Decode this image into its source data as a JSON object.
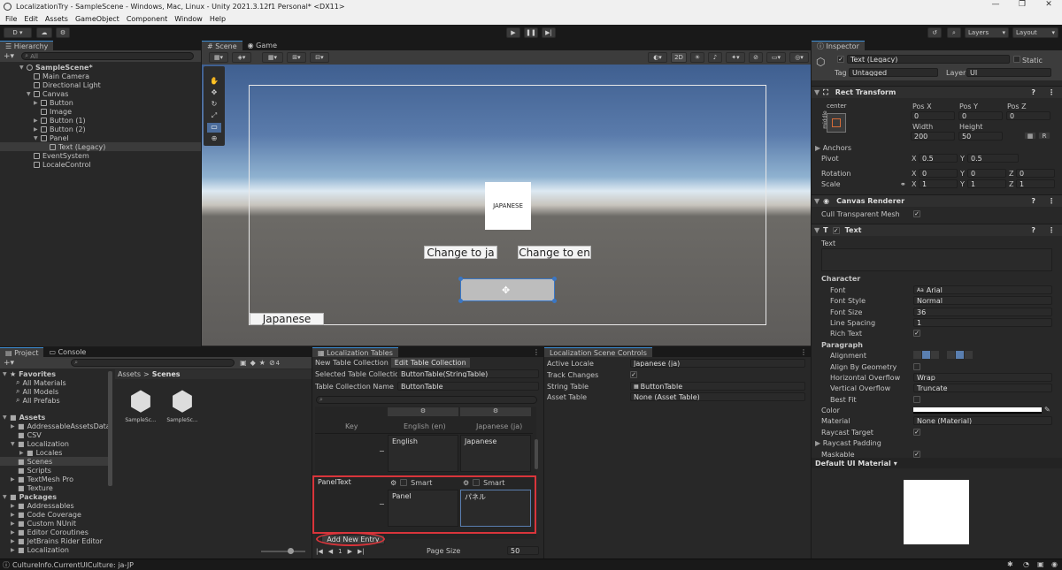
{
  "window": {
    "title": "LocalizationTry - SampleScene - Windows, Mac, Linux - Unity 2021.3.12f1 Personal* <DX11>",
    "minimize": "—",
    "maximize": "❐",
    "close": "✕"
  },
  "menu": [
    "File",
    "Edit",
    "Assets",
    "GameObject",
    "Component",
    "Window",
    "Help"
  ],
  "toolbar": {
    "account": "D",
    "layers": "Layers",
    "layout": "Layout"
  },
  "hierarchy": {
    "tab": "Hierarchy",
    "search_placeholder": "All",
    "items": [
      {
        "label": "SampleScene*",
        "depth": 0
      },
      {
        "label": "Main Camera",
        "depth": 1
      },
      {
        "label": "Directional Light",
        "depth": 1
      },
      {
        "label": "Canvas",
        "depth": 1
      },
      {
        "label": "Button",
        "depth": 2
      },
      {
        "label": "Image",
        "depth": 2
      },
      {
        "label": "Button (1)",
        "depth": 2
      },
      {
        "label": "Button (2)",
        "depth": 2
      },
      {
        "label": "Panel",
        "depth": 2
      },
      {
        "label": "Text (Legacy)",
        "depth": 3
      },
      {
        "label": "EventSystem",
        "depth": 1
      },
      {
        "label": "LocaleControl",
        "depth": 1
      }
    ]
  },
  "scene": {
    "tab_scene": "Scene",
    "tab_game": "Game",
    "mode_2d": "2D",
    "panel_text": "JAPANESE",
    "btn_ja": "Change to ja",
    "btn_en": "Change to en",
    "btn_japanese": "Japanese"
  },
  "inspector": {
    "tab": "Inspector",
    "object_name": "Text (Legacy)",
    "static_label": "Static",
    "tag_label": "Tag",
    "tag_value": "Untagged",
    "layer_label": "Layer",
    "layer_value": "UI",
    "rect_transform": "Rect Transform",
    "anchor_preset": "center",
    "anchor_side": "middle",
    "pos_x_label": "Pos X",
    "pos_x": "0",
    "pos_y_label": "Pos Y",
    "pos_y": "0",
    "pos_z_label": "Pos Z",
    "pos_z": "0",
    "width_label": "Width",
    "width": "200",
    "height_label": "Height",
    "height": "50",
    "anchors": "Anchors",
    "pivot_label": "Pivot",
    "pivot_x": "0.5",
    "pivot_y": "0.5",
    "rotation_label": "Rotation",
    "rot_x": "0",
    "rot_y": "0",
    "rot_z": "0",
    "scale_label": "Scale",
    "scale_x": "1",
    "scale_y": "1",
    "scale_z": "1",
    "canvas_renderer": "Canvas Renderer",
    "cull_label": "Cull Transparent Mesh",
    "text_component": "Text",
    "text_label": "Text",
    "character": "Character",
    "font_label": "Font",
    "font_value": "Arial",
    "font_style_label": "Font Style",
    "font_style_value": "Normal",
    "font_size_label": "Font Size",
    "font_size_value": "36",
    "line_spacing_label": "Line Spacing",
    "line_spacing_value": "1",
    "rich_text_label": "Rich Text",
    "paragraph": "Paragraph",
    "alignment_label": "Alignment",
    "align_geom_label": "Align By Geometry",
    "h_overflow_label": "Horizontal Overflow",
    "h_overflow_value": "Wrap",
    "v_overflow_label": "Vertical Overflow",
    "v_overflow_value": "Truncate",
    "best_fit_label": "Best Fit",
    "color_label": "Color",
    "material_label": "Material",
    "material_value": "None (Material)",
    "raycast_label": "Raycast Target",
    "raycast_padding_label": "Raycast Padding",
    "maskable_label": "Maskable",
    "default_material": "Default UI Material"
  },
  "project": {
    "tab_project": "Project",
    "tab_console": "Console",
    "favorites": "Favorites",
    "fav_items": [
      "All Materials",
      "All Models",
      "All Prefabs"
    ],
    "assets": "Assets",
    "asset_tree": [
      {
        "label": "AddressableAssetsData",
        "depth": 1
      },
      {
        "label": "CSV",
        "depth": 1
      },
      {
        "label": "Localization",
        "depth": 1
      },
      {
        "label": "Locales",
        "depth": 2
      },
      {
        "label": "Scenes",
        "depth": 1
      },
      {
        "label": "Scripts",
        "depth": 1
      },
      {
        "label": "TextMesh Pro",
        "depth": 1
      },
      {
        "label": "Texture",
        "depth": 1
      }
    ],
    "packages": "Packages",
    "package_items": [
      "Addressables",
      "Code Coverage",
      "Custom NUnit",
      "Editor Coroutines",
      "JetBrains Rider Editor",
      "Localization"
    ],
    "breadcrumb_root": "Assets",
    "breadcrumb_sep": ">",
    "breadcrumb_leaf": "Scenes",
    "files": [
      "SampleSc...",
      "SampleSc..."
    ],
    "hidden_count": "4"
  },
  "loc_tables": {
    "tab": "Localization Tables",
    "tab_new": "New Table Collection",
    "tab_edit": "Edit Table Collection",
    "selected_label": "Selected Table Collection",
    "selected_value": "ButtonTable(StringTable)",
    "name_label": "Table Collection Name",
    "name_value": "ButtonTable",
    "col_key": "Key",
    "col_en": "English (en)",
    "col_ja": "Japanese (ja)",
    "row1_en": "English",
    "row1_ja": "Japanese",
    "row2_key": "PanelText",
    "smart": "Smart",
    "row2_en": "Panel",
    "row2_ja": "パネル",
    "add_entry": "Add New Entry",
    "page_num": "1",
    "page_size_label": "Page Size",
    "page_size": "50"
  },
  "scene_controls": {
    "tab": "Localization Scene Controls",
    "active_locale_label": "Active Locale",
    "active_locale": "Japanese (ja)",
    "track_label": "Track Changes",
    "string_table_label": "String Table",
    "string_table": "ButtonTable",
    "asset_table_label": "Asset Table",
    "asset_table": "None (Asset Table)"
  },
  "status": {
    "text": "CultureInfo.CurrentUICulture: ja-JP"
  }
}
